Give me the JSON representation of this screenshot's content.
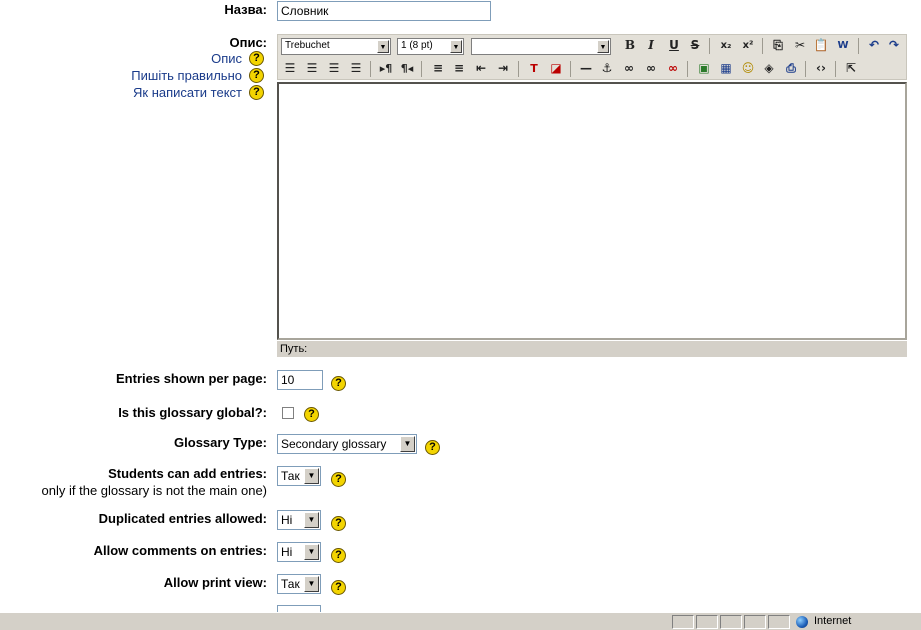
{
  "form": {
    "name": {
      "label": "Назва:",
      "value": "Словник"
    },
    "description": {
      "label": "Опис:",
      "help_links": [
        "Опис",
        "Пишіть правильно",
        "Як написати текст"
      ],
      "toolbar": {
        "font": "Trebuchet",
        "size": "1 (8 pt)",
        "style": ""
      },
      "path_label": "Путь:"
    },
    "entries_per_page": {
      "label": "Entries shown per page:",
      "value": "10"
    },
    "global": {
      "label": "Is this glossary global?:"
    },
    "glossary_type": {
      "label": "Glossary Type:",
      "value": "Secondary glossary"
    },
    "students_add": {
      "label": "Students can add entries:",
      "note": "only if the glossary is not the main one)",
      "value": "Так"
    },
    "duplicates": {
      "label": "Duplicated entries allowed:",
      "value": "Ні"
    },
    "comments": {
      "label": "Allow comments on entries:",
      "value": "Ні"
    },
    "print_view": {
      "label": "Allow print view:",
      "value": "Так"
    }
  },
  "statusbar": {
    "zone": "Internet"
  },
  "icons": {
    "help": "help-icon",
    "toolbar": [
      "bold-icon",
      "italic-icon",
      "underline-icon",
      "strikethrough-icon",
      "subscript-icon",
      "superscript-icon",
      "copy-icon",
      "cut-icon",
      "paste-icon",
      "paste-word-icon",
      "undo-icon",
      "redo-icon"
    ]
  },
  "colors": {
    "help_icon": "#f3d400",
    "link": "#1a3b8a",
    "toolbar_bg": "#e3e0d8"
  }
}
